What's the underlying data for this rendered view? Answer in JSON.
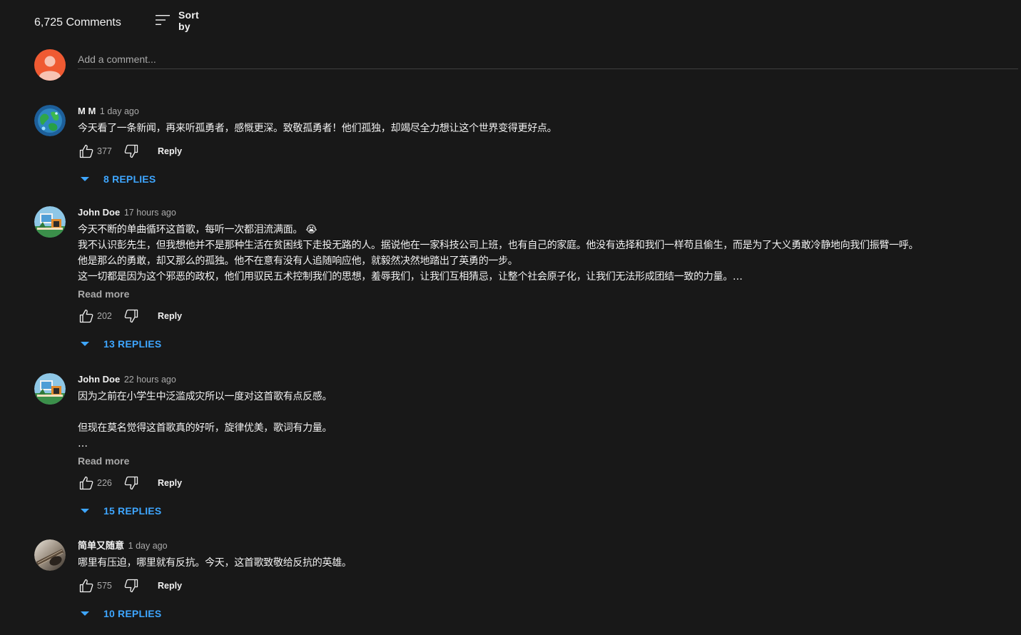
{
  "header": {
    "comment_count": "6,725 Comments",
    "sort_label": "Sort by"
  },
  "add_comment": {
    "placeholder": "Add a comment..."
  },
  "comments": [
    {
      "author": "M M",
      "time": "1 day ago",
      "text": "今天看了一条新闻，再来听孤勇者，感慨更深。致敬孤勇者！他们孤独，却竭尽全力想让这个世界变得更好点。",
      "read_more": "",
      "likes": "377",
      "reply_label": "Reply",
      "replies_label": "8 REPLIES",
      "avatar": "globe-avatar"
    },
    {
      "author": "John Doe",
      "time": "17 hours ago",
      "text": "今天不断的单曲循环这首歌，每听一次都泪流满面。 😭\n我不认识彭先生，但我想他并不是那种生活在贫困线下走投无路的人。据说他在一家科技公司上班，也有自己的家庭。他没有选择和我们一样苟且偷生，而是为了大义勇敢冷静地向我们振臂一呼。\n他是那么的勇敢，却又那么的孤独。他不在意有没有人追随响应他，就毅然决然地踏出了英勇的一步。\n这一切都是因为这个邪恶的政权，他们用驭民五术控制我们的思想，羞辱我们，让我们互相猜忌，让整个社会原子化，让我们无法形成团结一致的力量。…",
      "read_more": "Read more",
      "likes": "202",
      "reply_label": "Reply",
      "replies_label": "13 REPLIES",
      "avatar": "desk-avatar"
    },
    {
      "author": "John Doe",
      "time": "22 hours ago",
      "text": "因为之前在小学生中泛滥成灾所以一度对这首歌有点反感。\n\n但现在莫名觉得这首歌真的好听，旋律优美，歌词有力量。\n…",
      "read_more": "Read more",
      "likes": "226",
      "reply_label": "Reply",
      "replies_label": "15 REPLIES",
      "avatar": "desk-avatar"
    },
    {
      "author": "简单又随意",
      "time": "1 day ago",
      "text": "哪里有压迫，哪里就有反抗。今天，这首歌致敬给反抗的英雄。",
      "read_more": "",
      "likes": "575",
      "reply_label": "Reply",
      "replies_label": "10 REPLIES",
      "avatar": "guitar-avatar"
    }
  ],
  "colors": {
    "background": "#181818",
    "link_blue": "#3ea6ff",
    "muted_text": "#aaaaaa",
    "self_avatar": "#ef5a32"
  }
}
